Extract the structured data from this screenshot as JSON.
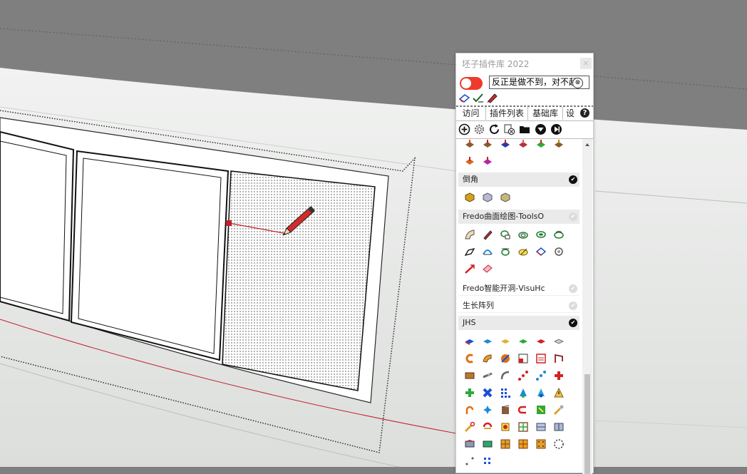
{
  "panel": {
    "title": "坯子插件库 2022",
    "close_glyph": "×",
    "search_value": "反正是做不到，对不起",
    "search_clear_glyph": "⊗",
    "tabs": [
      "访问",
      "插件列表",
      "基础库",
      "设置"
    ],
    "help_glyph": "?",
    "toolbar_icons": [
      "add-icon",
      "gear-icon",
      "refresh-icon",
      "uninstall-icon",
      "folder-icon",
      "collapse-icon",
      "expand-icon"
    ],
    "mini_icons": [
      "eraser-icon",
      "check-brush-icon",
      "pencil-icon"
    ]
  },
  "categories": [
    {
      "label": "倒角",
      "enabled": true
    },
    {
      "label": "Fredo曲面绘图-ToolsO",
      "enabled": false
    },
    {
      "label": "Fredo智能开洞-VisuHc",
      "enabled": false
    },
    {
      "label": "生长阵列",
      "enabled": false
    },
    {
      "label": "JHS",
      "enabled": true
    }
  ],
  "checkmark_glyph": "✔",
  "colors": {
    "toggle": "#ee3b2b",
    "viewport_sky": "#7f7f7f",
    "viewport_ground": "#eef0ee",
    "inference_line": "#c0202a"
  }
}
